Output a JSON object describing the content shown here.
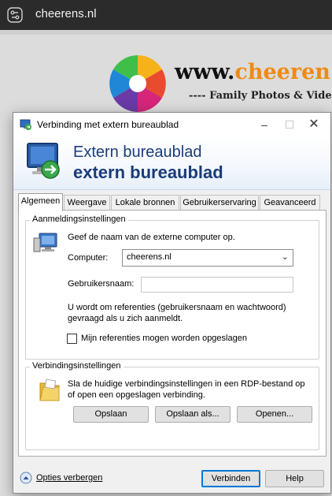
{
  "browser": {
    "url": "cheerens.nl"
  },
  "website": {
    "brand_prefix": "www.",
    "brand_accent": "cheeren",
    "tagline": "---- Family Photos & Vide"
  },
  "dialog": {
    "title": "Verbinding met extern bureaublad",
    "header_line1": "Extern bureaublad",
    "header_line2": "extern bureaublad",
    "tabs": [
      "Algemeen",
      "Weergave",
      "Lokale bronnen",
      "Gebruikerservaring",
      "Geavanceerd"
    ],
    "login_group": {
      "legend": "Aanmeldingsinstellingen",
      "intro": "Geef de naam van de externe computer op.",
      "computer_label": "Computer:",
      "computer_value": "cheerens.nl",
      "username_label": "Gebruikersnaam:",
      "username_value": "",
      "info_line1": "U wordt om referenties (gebruikersnaam en wachtwoord)",
      "info_line2": "gevraagd als u zich aanmeldt.",
      "save_creds_label": "Mijn referenties mogen worden opgeslagen",
      "save_creds_checked": false
    },
    "connection_group": {
      "legend": "Verbindingsinstellingen",
      "line1": "Sla de huidige verbindingsinstellingen in een RDP-bestand op",
      "line2": "of open een opgeslagen verbinding.",
      "save_btn": "Opslaan",
      "save_as_btn": "Opslaan als...",
      "open_btn": "Openen..."
    },
    "footer": {
      "hide_options": "Opties verbergen",
      "connect_btn": "Verbinden",
      "help_btn": "Help"
    }
  },
  "colors": {
    "header_text": "#1a3c7a",
    "brand_accent": "#f08a12",
    "focus_blue": "#0078d7"
  }
}
